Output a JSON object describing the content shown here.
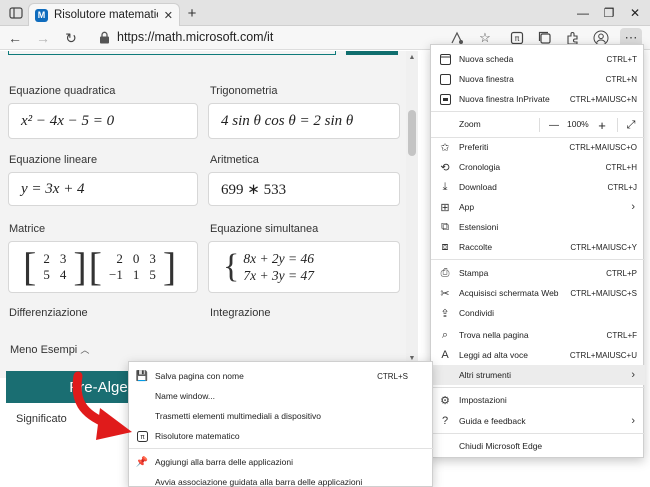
{
  "tab": {
    "title": "Risolutore matematico Microsoft",
    "close": "✕",
    "favicon_text": "M"
  },
  "titlebar": {
    "new_tab": "+",
    "window_buttons": [
      "—",
      "❐",
      "✕"
    ]
  },
  "nav": {
    "url": "https://math.microsoft.com/it"
  },
  "examples": [
    {
      "label": "Equazione quadratica",
      "expr": "x² − 4x − 5 = 0"
    },
    {
      "label": "Trigonometria",
      "expr": "4 sin θ cos θ = 2 sin θ"
    },
    {
      "label": "Equazione lineare",
      "expr": "y = 3x + 4"
    },
    {
      "label": "Aritmetica",
      "expr": "699 ∗ 533"
    },
    {
      "label": "Matrice"
    },
    {
      "label": "Equazione simultanea"
    },
    {
      "label": "Differenziazione"
    },
    {
      "label": "Integrazione"
    }
  ],
  "matrix": {
    "a": [
      [
        "2",
        "3"
      ],
      [
        "5",
        "4"
      ]
    ],
    "b": [
      [
        "2",
        "0",
        "3"
      ],
      [
        "−1",
        "1",
        "5"
      ]
    ]
  },
  "simultaneous": [
    "8x + 2y = 46",
    "7x + 3y = 47"
  ],
  "meno_esempi": "Meno Esempi",
  "pre_algebra": "Pre-Algeb",
  "significato": "Significato",
  "menu": {
    "items": [
      {
        "label": "Nuova scheda",
        "shortcut": "CTRL+T",
        "icon": "new-tab-icon"
      },
      {
        "label": "Nuova finestra",
        "shortcut": "CTRL+N",
        "icon": "new-window-icon"
      },
      {
        "label": "Nuova finestra InPrivate",
        "shortcut": "CTRL+MAIUSC+N",
        "icon": "inprivate-icon"
      },
      {
        "label": "Preferiti",
        "shortcut": "CTRL+MAIUSC+O",
        "icon": "favorites-icon"
      },
      {
        "label": "Cronologia",
        "shortcut": "CTRL+H",
        "icon": "history-icon"
      },
      {
        "label": "Download",
        "shortcut": "CTRL+J",
        "icon": "download-icon"
      },
      {
        "label": "App",
        "shortcut": "",
        "icon": "apps-icon"
      },
      {
        "label": "Estensioni",
        "shortcut": "",
        "icon": "extensions-icon"
      },
      {
        "label": "Raccolte",
        "shortcut": "CTRL+MAIUSC+Y",
        "icon": "collections-icon"
      },
      {
        "label": "Stampa",
        "shortcut": "CTRL+P",
        "icon": "print-icon"
      },
      {
        "label": "Acquisisci schermata Web",
        "shortcut": "CTRL+MAIUSC+S",
        "icon": "web-capture-icon"
      },
      {
        "label": "Condividi",
        "shortcut": "",
        "icon": "share-icon"
      },
      {
        "label": "Trova nella pagina",
        "shortcut": "CTRL+F",
        "icon": "find-icon"
      },
      {
        "label": "Leggi ad alta voce",
        "shortcut": "CTRL+MAIUSC+U",
        "icon": "read-aloud-icon"
      },
      {
        "label": "Altri strumenti",
        "shortcut": "",
        "icon": ""
      },
      {
        "label": "Impostazioni",
        "shortcut": "",
        "icon": "settings-icon"
      },
      {
        "label": "Guida e feedback",
        "shortcut": "",
        "icon": "help-icon"
      },
      {
        "label": "Chiudi Microsoft Edge",
        "shortcut": "",
        "icon": ""
      }
    ],
    "zoom": {
      "label": "Zoom",
      "value": "100%",
      "minus": "—",
      "plus": "+"
    }
  },
  "submenu": {
    "items": [
      {
        "label": "Salva pagina con nome",
        "shortcut": "CTRL+S",
        "icon": "save-page-icon"
      },
      {
        "label": "Name window...",
        "shortcut": "",
        "icon": ""
      },
      {
        "label": "Trasmetti elementi multimediali a dispositivo",
        "shortcut": "",
        "icon": ""
      },
      {
        "label": "Risolutore matematico",
        "shortcut": "",
        "icon": "math-solver-icon"
      },
      {
        "label": "Aggiungi alla barra delle applicazioni",
        "shortcut": "",
        "icon": "pin-icon"
      },
      {
        "label": "Avvia associazione guidata alla barra delle applicazioni",
        "shortcut": "",
        "icon": ""
      }
    ]
  },
  "colors": {
    "teal": "#1a6e72",
    "arrow_red": "#e01b1b",
    "highlight": "#ececec"
  }
}
